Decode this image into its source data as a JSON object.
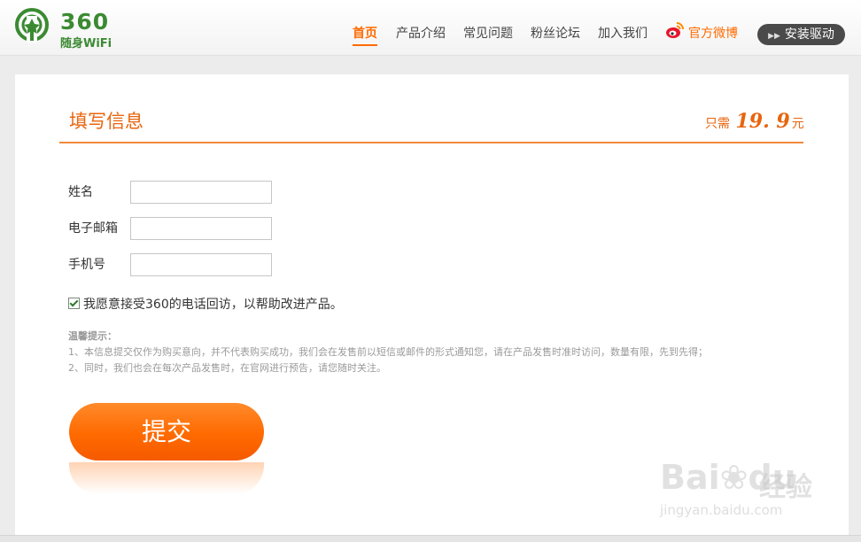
{
  "logo": {
    "number": "360",
    "sub": "随身WiFi"
  },
  "nav": {
    "items": [
      {
        "label": "首页",
        "active": true
      },
      {
        "label": "产品介绍"
      },
      {
        "label": "常见问题"
      },
      {
        "label": "粉丝论坛"
      },
      {
        "label": "加入我们"
      }
    ],
    "weibo_label": "官方微博",
    "install_label": "安装驱动"
  },
  "form": {
    "title": "填写信息",
    "price_prefix": "只需",
    "price_value": "19. 9",
    "price_suffix": "元",
    "fields": [
      {
        "label": "姓名",
        "value": ""
      },
      {
        "label": "电子邮箱",
        "value": ""
      },
      {
        "label": "手机号",
        "value": ""
      }
    ],
    "consent_text": "我愿意接受360的电话回访，以帮助改进产品。",
    "consent_checked": true,
    "tips_title": "温馨提示：",
    "tips": [
      "1、本信息提交仅作为购买意向，并不代表购买成功，我们会在发售前以短信或邮件的形式通知您，请在产品发售时准时访问，数量有限，先到先得；",
      "2、同时，我们也会在每次产品发售时，在官网进行预告，请您随时关注。"
    ],
    "submit_label": "提交"
  },
  "watermark": {
    "text": "Bai",
    "text2": "du",
    "cn": "经验",
    "url": "jingyan.baidu.com"
  },
  "colors": {
    "accent": "#ff6a00",
    "brand_green": "#3b8a32"
  }
}
